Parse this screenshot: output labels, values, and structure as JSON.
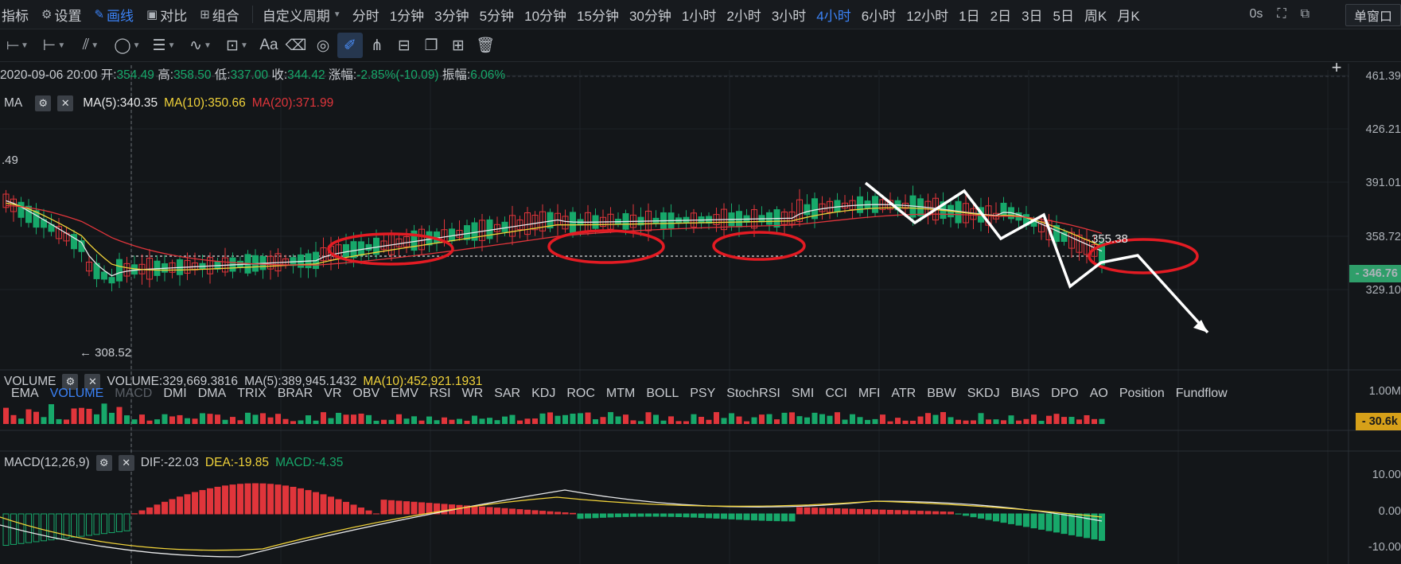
{
  "toolbar": {
    "items": [
      {
        "label": "指标",
        "icon": "indicator-icon"
      },
      {
        "label": "设置",
        "icon": "settings-icon"
      },
      {
        "label": "画线",
        "icon": "draw-line-icon"
      },
      {
        "label": "对比",
        "icon": "compare-icon"
      },
      {
        "label": "组合",
        "icon": "combine-icon"
      }
    ],
    "custom_period": "自定义周期",
    "periods": [
      "分时",
      "1分钟",
      "3分钟",
      "5分钟",
      "10分钟",
      "15分钟",
      "30分钟",
      "1小时",
      "2小时",
      "3小时",
      "4小时",
      "6小时",
      "12小时",
      "1日",
      "2日",
      "3日",
      "5日",
      "周K",
      "月K"
    ],
    "active_period": "4小时",
    "countdown": "0s",
    "window_mode": "单窗口"
  },
  "drawing_tools": [
    "horizontal-line-icon",
    "ray-line-icon",
    "fib-icon",
    "ellipse-icon",
    "parallel-icon",
    "wave-icon",
    "measure-icon",
    "text-tool-icon",
    "eraser-icon",
    "hide-icon",
    "pen-icon",
    "magnet-icon",
    "lock-icon",
    "copy-icon",
    "layout-icon",
    "trash-icon"
  ],
  "ohlc": {
    "time": "2020-09-06 20:00",
    "open_label": "开:",
    "open": "354.49",
    "high_label": "高:",
    "high": "358.50",
    "low_label": "低:",
    "low": "337.00",
    "close_label": "收:",
    "close": "344.42",
    "change_label": "涨幅:",
    "change": "-2.85%(-10.09)",
    "amplitude_label": "振幅:",
    "amplitude": "6.06%"
  },
  "ma": {
    "label": "MA",
    "ma5": "MA(5):340.35",
    "ma10": "MA(10):350.66",
    "ma20": "MA(20):371.99"
  },
  "volume": {
    "label": "VOLUME",
    "value": "VOLUME:329,669.3816",
    "ma5": "MA(5):389,945.1432",
    "ma10": "MA(10):452,921.1931"
  },
  "indicator_tabs": [
    "EMA",
    "VOLUME",
    "MACD",
    "DMI",
    "DMA",
    "TRIX",
    "BRAR",
    "VR",
    "OBV",
    "EMV",
    "RSI",
    "WR",
    "SAR",
    "KDJ",
    "ROC",
    "MTM",
    "BOLL",
    "PSY",
    "StochRSI",
    "SMI",
    "CCI",
    "MFI",
    "ATR",
    "BBW",
    "SKDJ",
    "BIAS",
    "DPO",
    "AO",
    "Position",
    "Fundflow"
  ],
  "active_indicator_tab": "VOLUME",
  "disabled_indicator_tab": "MACD",
  "macd": {
    "label": "MACD(12,26,9)",
    "dif": "DIF:-22.03",
    "dea": "DEA:-19.85",
    "macd": "MACD:-4.35"
  },
  "price_axis": [
    "461.39",
    "426.21",
    "391.01",
    "358.72",
    "329.10"
  ],
  "current_price": "346.76",
  "volume_axis": [
    "1.00M"
  ],
  "current_volume": "30.6k",
  "macd_axis": [
    "10.00",
    "0.00",
    "-10.00"
  ],
  "annotations": {
    "low_marker": "← 308.52",
    "left_value": ".49",
    "level_label": "355.38"
  },
  "colors": {
    "up": "#e0353b",
    "down": "#17a86a",
    "ma5": "#e8e9ea",
    "ma10": "#f1d33a",
    "ma20": "#e0353b",
    "accent": "#3b82f6",
    "circle": "#e31b23",
    "price_badge": "#2f9e6a",
    "volume_badge": "#d6a019"
  }
}
